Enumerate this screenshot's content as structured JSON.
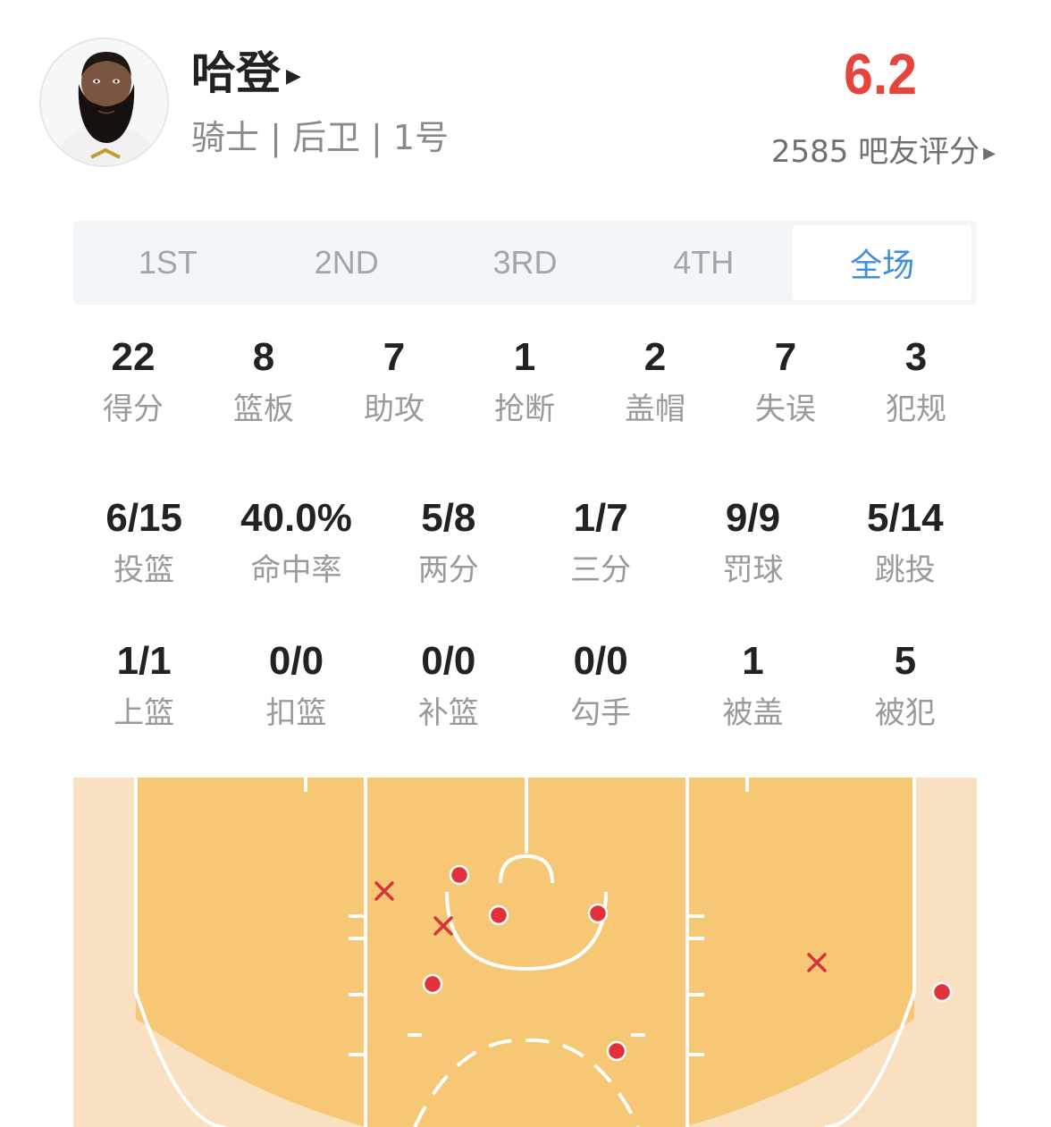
{
  "player": {
    "name": "哈登",
    "meta": "骑士 | 后卫 | 1号",
    "avatar_icon": "player-headshot"
  },
  "rating": {
    "score": "6.2",
    "count_text": "2585 吧友评分"
  },
  "tabs": [
    {
      "label": "1ST",
      "active": false
    },
    {
      "label": "2ND",
      "active": false
    },
    {
      "label": "3RD",
      "active": false
    },
    {
      "label": "4TH",
      "active": false
    },
    {
      "label": "全场",
      "active": true
    }
  ],
  "stats_row1": [
    {
      "value": "22",
      "label": "得分"
    },
    {
      "value": "8",
      "label": "篮板"
    },
    {
      "value": "7",
      "label": "助攻"
    },
    {
      "value": "1",
      "label": "抢断"
    },
    {
      "value": "2",
      "label": "盖帽"
    },
    {
      "value": "7",
      "label": "失误"
    },
    {
      "value": "3",
      "label": "犯规"
    }
  ],
  "stats_row2": [
    {
      "value": "6/15",
      "label": "投篮"
    },
    {
      "value": "40.0%",
      "label": "命中率"
    },
    {
      "value": "5/8",
      "label": "两分"
    },
    {
      "value": "1/7",
      "label": "三分"
    },
    {
      "value": "9/9",
      "label": "罚球"
    },
    {
      "value": "5/14",
      "label": "跳投"
    }
  ],
  "stats_row3": [
    {
      "value": "1/1",
      "label": "上篮"
    },
    {
      "value": "0/0",
      "label": "扣篮"
    },
    {
      "value": "0/0",
      "label": "补篮"
    },
    {
      "value": "0/0",
      "label": "勾手"
    },
    {
      "value": "1",
      "label": "被盖"
    },
    {
      "value": "5",
      "label": "被犯"
    }
  ],
  "colors": {
    "accent_red": "#e6433b",
    "tab_active": "#3d8fdc",
    "court_fill": "#f6c774",
    "court_edge": "#f8e0c0",
    "made_shot": "#e2313a",
    "missed_shot": "#d8323a"
  },
  "shot_chart": {
    "made_icon": "made-shot-dot",
    "missed_icon": "missed-shot-x",
    "shots": [
      {
        "result": "made"
      },
      {
        "result": "made"
      },
      {
        "result": "made"
      },
      {
        "result": "made"
      },
      {
        "result": "made"
      },
      {
        "result": "made"
      },
      {
        "result": "missed"
      },
      {
        "result": "missed"
      },
      {
        "result": "missed"
      }
    ]
  }
}
